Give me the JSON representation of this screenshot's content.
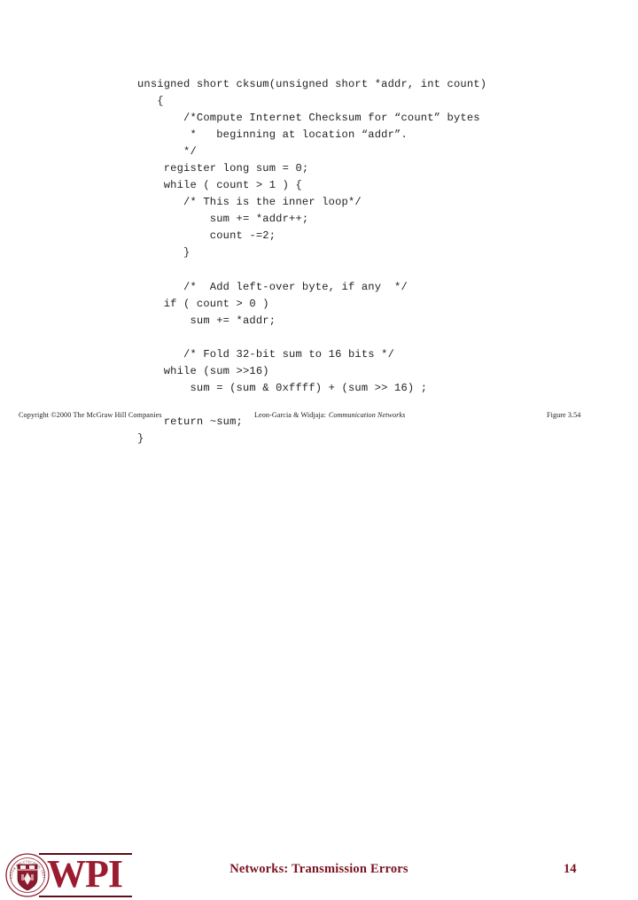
{
  "slide": {
    "background_color": "#ffffff",
    "title": "Networks: Transmission Errors",
    "page_number": "14",
    "accent_color": "#7b1220",
    "logo_color": "#9b1b30"
  },
  "figure": {
    "code_language": "c",
    "code_lines": [
      "unsigned short cksum(unsigned short *addr, int count)",
      "   {",
      "       /*Compute Internet Checksum for “count” bytes",
      "        *   beginning at location “addr”.",
      "       */",
      "    register long sum = 0;",
      "    while ( count > 1 ) {",
      "       /* This is the inner loop*/",
      "           sum += *addr++;",
      "           count -=2;",
      "       }",
      "",
      "       /*  Add left-over byte, if any  */",
      "    if ( count > 0 )",
      "        sum += *addr;",
      "",
      "       /* Fold 32-bit sum to 16 bits */",
      "    while (sum >>16)",
      "        sum = (sum & 0xffff) + (sum >> 16) ;",
      "",
      "    return ~sum;",
      "}"
    ]
  },
  "footer": {
    "copyright": "Copyright ©2000 The McGraw Hill Companies",
    "source_authors": "Leon-Garcia & Widjaja:",
    "source_book_title": "Communication Networks",
    "figure_number": "Figure 3.54"
  },
  "logo": {
    "wordmark": "WPI",
    "seal_outer_text": "WORCESTER POLYTECHNIC INSTITUTE",
    "seal_year": "1865"
  }
}
